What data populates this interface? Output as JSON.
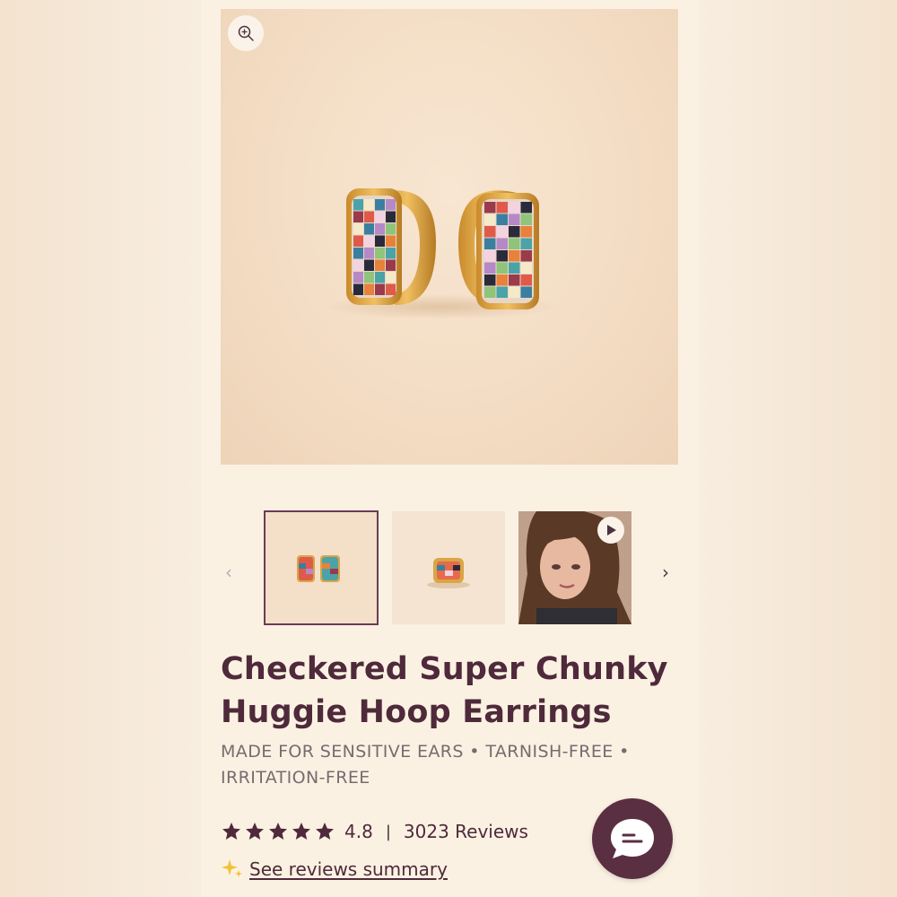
{
  "product": {
    "title": "Checkered Super Chunky Huggie Hoop Earrings",
    "subtitle": "MADE FOR SENSITIVE EARS • TARNISH-FREE • IRRITATION-FREE",
    "rating": "4.8",
    "rating_stars": 5,
    "separator": "|",
    "reviews": "3023 Reviews",
    "reviews_summary_link": "See reviews summary"
  },
  "gallery": {
    "prev_arrow": "‹",
    "next_arrow": "›",
    "thumbnails": [
      {
        "kind": "image",
        "selected": true
      },
      {
        "kind": "image",
        "selected": false
      },
      {
        "kind": "video",
        "selected": false
      }
    ]
  },
  "icons": {
    "zoom": "zoom-in-icon",
    "play": "play-icon",
    "sparkle": "sparkle-icon",
    "star": "star-icon",
    "chat": "chat-icon"
  },
  "colors": {
    "brand": "#4e2a3a",
    "chat_button": "#5a2f42",
    "page_bg": "#fbf1e3",
    "sparkle": "#f2c230"
  }
}
